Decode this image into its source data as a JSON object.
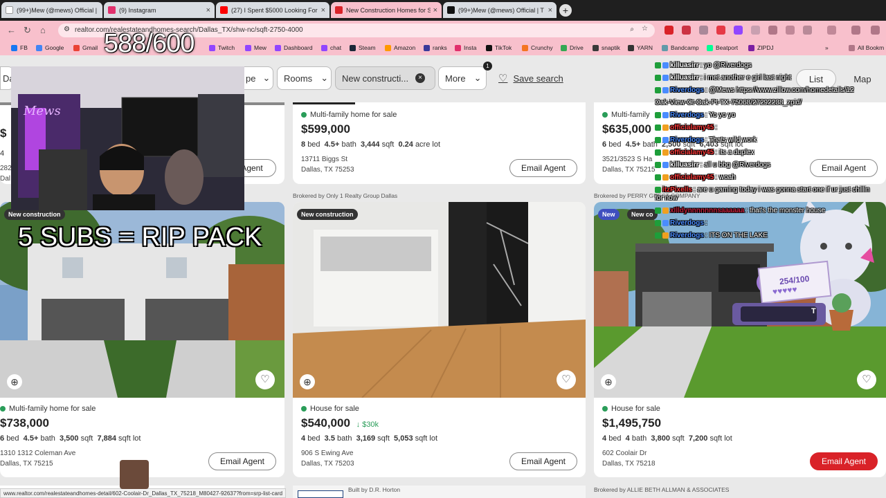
{
  "browser": {
    "tabs": [
      {
        "title": "(99+)Mew (@mews) Official | T",
        "icon_color": "#ffffff"
      },
      {
        "title": "(9) Instagram",
        "icon_color": "#e1306c"
      },
      {
        "title": "(27) I Spent $5000 Looking For",
        "icon_color": "#ff0000"
      },
      {
        "title": "New Construction Homes for S",
        "icon_color": "#d92228"
      },
      {
        "title": "(99+)Mew (@mews) Official | T",
        "icon_color": "#111111"
      }
    ],
    "new_tab_glyph": "+",
    "tab_close_glyph": "×",
    "url": "realtor.com/realestateandhomes-search/Dallas_TX/shw-nc/sqft-2750-4000",
    "bookmarks": [
      {
        "label": "FB",
        "color": "#1877f2"
      },
      {
        "label": "Google",
        "color": "#4285f4"
      },
      {
        "label": "Gmail",
        "color": "#ea4335"
      },
      {
        "label": "Twitch",
        "color": "#9146ff"
      },
      {
        "label": "Mew",
        "color": "#9146ff"
      },
      {
        "label": "Dashboard",
        "color": "#9146ff"
      },
      {
        "label": "chat",
        "color": "#9146ff"
      },
      {
        "label": "Steam",
        "color": "#1b2838"
      },
      {
        "label": "Amazon",
        "color": "#ff9900"
      },
      {
        "label": "ranks",
        "color": "#3a3a9a"
      },
      {
        "label": "Insta",
        "color": "#e1306c"
      },
      {
        "label": "TikTok",
        "color": "#111111"
      },
      {
        "label": "Crunchy",
        "color": "#f47521"
      },
      {
        "label": "Drive",
        "color": "#34a853"
      },
      {
        "label": "snaptik",
        "color": "#3a3a3a"
      },
      {
        "label": "YARN",
        "color": "#333333"
      },
      {
        "label": "Bandcamp",
        "color": "#629aa9"
      },
      {
        "label": "Beatport",
        "color": "#01ff95"
      },
      {
        "label": "ZIPDJ",
        "color": "#7a1fa2"
      }
    ],
    "all_bookmarks": "All Bookm"
  },
  "filters": {
    "partial_left": "Da",
    "partial_type": "pe",
    "rooms": "Rooms",
    "new_construction": "New constructi...",
    "more": "More",
    "more_badge": "1",
    "save_search": "Save search",
    "list": "List",
    "map": "Map"
  },
  "listings_top": [
    {
      "status": "",
      "price": "$",
      "specs_beds": "4",
      "addr1": "282",
      "addr2": "Dal",
      "email": "Agent"
    },
    {
      "status": "Multi-family home for sale",
      "price": "$599,000",
      "beds": "8",
      "baths": "4.5+",
      "sqft": "3,444",
      "lot": "0.24",
      "lot_unit": "acre lot",
      "addr1": "13711 Biggs St",
      "addr2": "Dallas, TX 75253",
      "email": "Email Agent"
    },
    {
      "status": "Multi-family",
      "price": "$635,000",
      "beds": "6",
      "baths": "4.5+",
      "sqft": "2,500",
      "lot": "6,403",
      "lot_unit": "sqft lot",
      "addr1": "3521/3523 S Ha",
      "addr2": "Dallas, TX 75215",
      "email": "Email Agent"
    }
  ],
  "brokers_mid": [
    "Brokered by Only 1 Realty Group Dallas",
    "Brokered by PERRY GUEST COMPANY"
  ],
  "listings_bottom": [
    {
      "badge": "New construction",
      "status": "Multi-family home for sale",
      "price": "$738,000",
      "drop": "",
      "beds": "6",
      "baths": "4.5+",
      "sqft": "3,500",
      "lot": "7,884",
      "addr1": "1310 1312 Coleman Ave",
      "addr2": "Dallas, TX 75215",
      "email": "Email Agent"
    },
    {
      "badge": "New construction",
      "status": "House for sale",
      "price": "$540,000",
      "drop": "↓ $30k",
      "beds": "4",
      "baths": "3.5",
      "sqft": "3,169",
      "lot": "5,053",
      "addr1": "906 S Ewing Ave",
      "addr2": "Dallas, TX 75203",
      "email": "Email Agent"
    },
    {
      "badge": "New",
      "badge2": "New co",
      "status": "House for sale",
      "price": "$1,495,750",
      "drop": "",
      "beds": "4",
      "baths": "4",
      "sqft": "3,800",
      "lot": "7,200",
      "addr1": "602 Coolair Dr",
      "addr2": "Dallas, TX 75218",
      "email": "Email Agent"
    }
  ],
  "labels": {
    "bed": "bed",
    "bath": "bath",
    "sqft": "sqft",
    "sqft_lot": "sqft lot"
  },
  "brokers_bottom": [
    "Built by D.R. Horton",
    "Brokered by ALLIE BETH ALLMAN & ASSOCIATES"
  ],
  "status_url": "www.realtor.com/realestateandhomes-detail/602-Coolair-Dr_Dallas_TX_75218_M80427-92637?from=srp-list-card",
  "stream": {
    "counter": "588/600",
    "subs_banner": "5 SUBS = RIP PACK",
    "goal": "254/100",
    "goal_hearts": "♥♥♥♥♥",
    "goal_input_glyph": "T",
    "webcam_name": "Mews"
  },
  "chat": [
    {
      "name": "killuasirr",
      "msg": ": yo @Riverdogs",
      "color": "#ffffff"
    },
    {
      "name": "killuasirr",
      "msg": ": i met another e girl last night",
      "color": "#ffffff"
    },
    {
      "name": "Riverdogs",
      "msg": ": @Mews https://www.zillow.com/homedetails/12",
      "color": "#4a8cff"
    },
    {
      "name": "",
      "msg": "Oak-View-Ct-Oak-Pt-TX-75068/27292238_zpid/",
      "color": "#ffffff"
    },
    {
      "name": "Riverdogs",
      "msg": ": Yo yo yo",
      "color": "#4a8cff"
    },
    {
      "name": "officialamy45",
      "msg": ":",
      "color": "#ff3b3b"
    },
    {
      "name": "Riverdogs",
      "msg": ": Thats wild work",
      "color": "#4a8cff"
    },
    {
      "name": "officialamy45",
      "msg": ": its a duplex",
      "color": "#ff3b3b"
    },
    {
      "name": "killuasirr",
      "msg": ": all u bbg @Riverdogs",
      "color": "#ffffff"
    },
    {
      "name": "officialamy45",
      "msg": ": woah",
      "color": "#ff3b3b"
    },
    {
      "name": "itzPixells",
      "msg": ": are u gaming today i was gonna start one if ur just chillin",
      "color": "#ff3b3b"
    },
    {
      "name": "",
      "msg": "for now",
      "color": "#ffffff"
    },
    {
      "name": "xIlldynnnnnnnsaaaaaa",
      "msg": ": that's the monster house",
      "color": "#c21e3a"
    },
    {
      "name": "Riverdogs",
      "msg": ":",
      "color": "#4a8cff"
    },
    {
      "name": "Riverdogs",
      "msg": ": ITS ON THE LAKE",
      "color": "#4a8cff"
    }
  ]
}
